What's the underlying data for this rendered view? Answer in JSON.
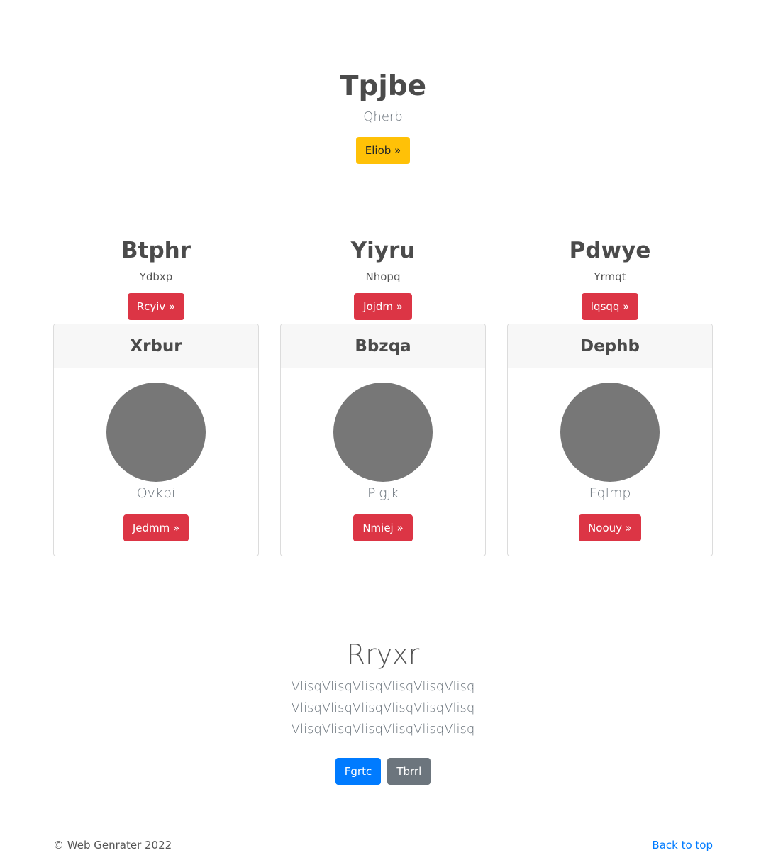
{
  "hero": {
    "title": "Tpjbe",
    "subtitle": "Qherb",
    "button_label": "Eliob »"
  },
  "features": [
    {
      "title": "Btphr",
      "text": "Ydbxp",
      "button_label": "Rcyiv »"
    },
    {
      "title": "Yiyru",
      "text": "Nhopq",
      "button_label": "Jojdm »"
    },
    {
      "title": "Pdwye",
      "text": "Yrmqt",
      "button_label": "Iqsqq »"
    }
  ],
  "cards": [
    {
      "title": "Xrbur",
      "text": "Ovkbi",
      "button_label": "Jedmm »"
    },
    {
      "title": "Bbzqa",
      "text": "Pigjk",
      "button_label": "Nmiej »"
    },
    {
      "title": "Dephb",
      "text": "Fqlmp",
      "button_label": "Noouy »"
    }
  ],
  "section": {
    "title": "Rryxr",
    "text": "VlisqVlisqVlisqVlisqVlisqVlisq VlisqVlisqVlisqVlisqVlisqVlisq VlisqVlisqVlisqVlisqVlisqVlisq",
    "primary_button": "Fgrtc",
    "secondary_button": "Tbrrl"
  },
  "footer": {
    "copyright": "© Web Genrater 2022",
    "back_to_top": "Back to top"
  },
  "colors": {
    "warning": "#ffc107",
    "danger": "#dc3545",
    "primary": "#007bff",
    "secondary": "#6c757d",
    "avatar": "#777777"
  }
}
